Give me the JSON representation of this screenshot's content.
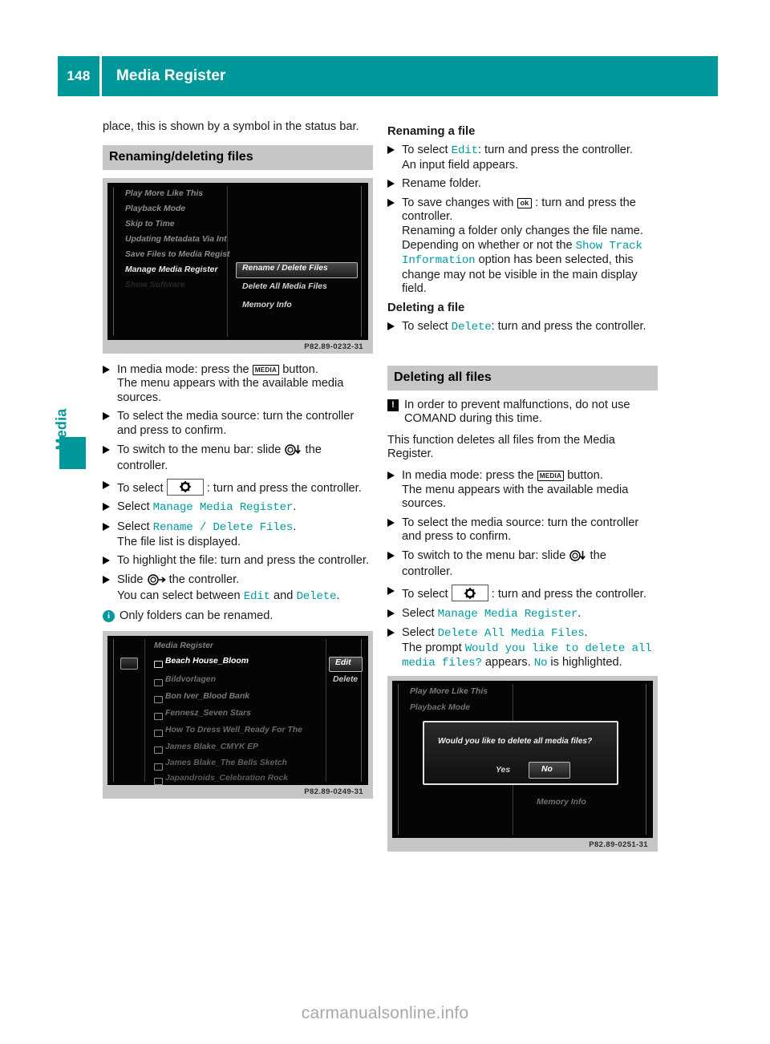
{
  "header": {
    "page_number": "148",
    "title": "Media Register"
  },
  "sidebar": {
    "tab_label": "Media"
  },
  "left_column": {
    "intro_paragraph": "place, this is shown by a symbol in the status bar.",
    "section_heading": "Renaming/deleting files",
    "screenshot_1": {
      "caption": "P82.89-0232-31",
      "left_menu": [
        "Play More Like This",
        "Playback Mode",
        "Skip to Time",
        "Updating Metadata Via Int",
        "Save Files to Media Regist",
        "Manage Media Register",
        "Show Software"
      ],
      "right_menu": [
        "Rename / Delete Files",
        "Delete All Media Files",
        "Memory Info"
      ],
      "highlighted_item": "Rename / Delete Files"
    },
    "steps": [
      {
        "id": "media-button",
        "lead": "In media mode: press the",
        "key": "MEDIA",
        "tail": "button.",
        "cont": "The menu appears with the available media sources."
      },
      {
        "id": "select-media-source",
        "text": "To select the media source: turn the controller and press to confirm."
      },
      {
        "id": "switch-menu-bar",
        "lead": "To switch to the menu bar: slide",
        "icon": "controller-down-icon",
        "tail": "the controller."
      },
      {
        "id": "select-gear",
        "lead": "To select",
        "icon": "system-settings-icon",
        "tail": ": turn and press the controller."
      },
      {
        "id": "select-manage",
        "lead": "Select",
        "mono": "Manage Media Register",
        "tail": "."
      },
      {
        "id": "select-rename-delete",
        "lead": "Select",
        "mono": "Rename / Delete Files",
        "tail": ".",
        "cont": "The file list is displayed."
      },
      {
        "id": "highlight-file",
        "text": "To highlight the file: turn and press the controller."
      },
      {
        "id": "slide-controller",
        "lead": "Slide",
        "icon": "controller-right-icon",
        "tail": "the controller.",
        "cont_pre": "You can select between",
        "cont_mono_1": "Edit",
        "cont_mid": "and",
        "cont_mono_2": "Delete",
        "cont_post": "."
      }
    ],
    "info_note": "Only folders can be renamed.",
    "screenshot_2": {
      "caption": "P82.89-0249-31",
      "list_title": "Media Register",
      "files": [
        "Beach House_Bloom",
        "Bildvorlagen",
        "Bon Iver_Blood Bank",
        "Fennesz_Seven Stars",
        "How To Dress Well_Ready For The",
        "James Blake_CMYK EP",
        "James Blake_The Bells Sketch",
        "Japandroids_Celebration Rock"
      ],
      "highlighted_file": "Beach House_Bloom",
      "side_actions": [
        "Edit",
        "Delete"
      ],
      "highlighted_action": "Edit"
    }
  },
  "right_column": {
    "renaming_heading": "Renaming a file",
    "renaming_steps": [
      {
        "id": "select-edit",
        "lead": "To select",
        "mono": "Edit",
        "tail": ": turn and press the controller.",
        "cont": "An input field appears."
      },
      {
        "id": "rename-folder",
        "text": "Rename folder."
      },
      {
        "id": "save-changes",
        "lead": "To save changes with",
        "key": "ok",
        "tail": ": turn and press the controller.",
        "cont_1": "Renaming a folder only changes the file name. Depending on whether or not the",
        "cont_mono": "Show Track Information",
        "cont_2": "option has been selected, this change may not be visible in the main display field."
      }
    ],
    "deleting_file_heading": "Deleting a file",
    "deleting_file_step": {
      "lead": "To select",
      "mono": "Delete",
      "tail": ": turn and press the controller."
    },
    "deleting_all_heading": "Deleting all files",
    "warning_note": "In order to prevent malfunctions, do not use COMAND during this time.",
    "function_paragraph": "This function deletes all files from the Media Register.",
    "deleting_all_steps": [
      {
        "id": "media-button-2",
        "lead": "In media mode: press the",
        "key": "MEDIA",
        "tail": "button.",
        "cont": "The menu appears with the available media sources."
      },
      {
        "id": "select-media-source-2",
        "text": "To select the media source: turn the controller and press to confirm."
      },
      {
        "id": "switch-menu-bar-2",
        "lead": "To switch to the menu bar: slide",
        "icon": "controller-down-icon",
        "tail": "the controller."
      },
      {
        "id": "select-gear-2",
        "lead": "To select",
        "icon": "system-settings-icon",
        "tail": ": turn and press the controller."
      },
      {
        "id": "select-manage-2",
        "lead": "Select",
        "mono": "Manage Media Register",
        "tail": "."
      },
      {
        "id": "select-delete-all",
        "lead": "Select",
        "mono": "Delete All Media Files",
        "tail": ".",
        "cont_pre": "The prompt",
        "cont_mono": "Would you like to delete all media files?",
        "cont_mid": "appears.",
        "cont_mono_2": "No",
        "cont_post": "is highlighted."
      }
    ],
    "screenshot_3": {
      "caption": "P82.89-0251-31",
      "background_items": [
        "Play More Like This",
        "Playback Mode",
        "Memory Info"
      ],
      "dialog_text": "Would you like to delete all media files?",
      "buttons": [
        "Yes",
        "No"
      ],
      "highlighted_button": "No"
    }
  },
  "footer": {
    "watermark": "carmanualsonline.info"
  },
  "colors": {
    "accent_teal": "#00989b",
    "section_bar_gray": "#c6c6c6",
    "mono_teal": "#009ba0"
  }
}
